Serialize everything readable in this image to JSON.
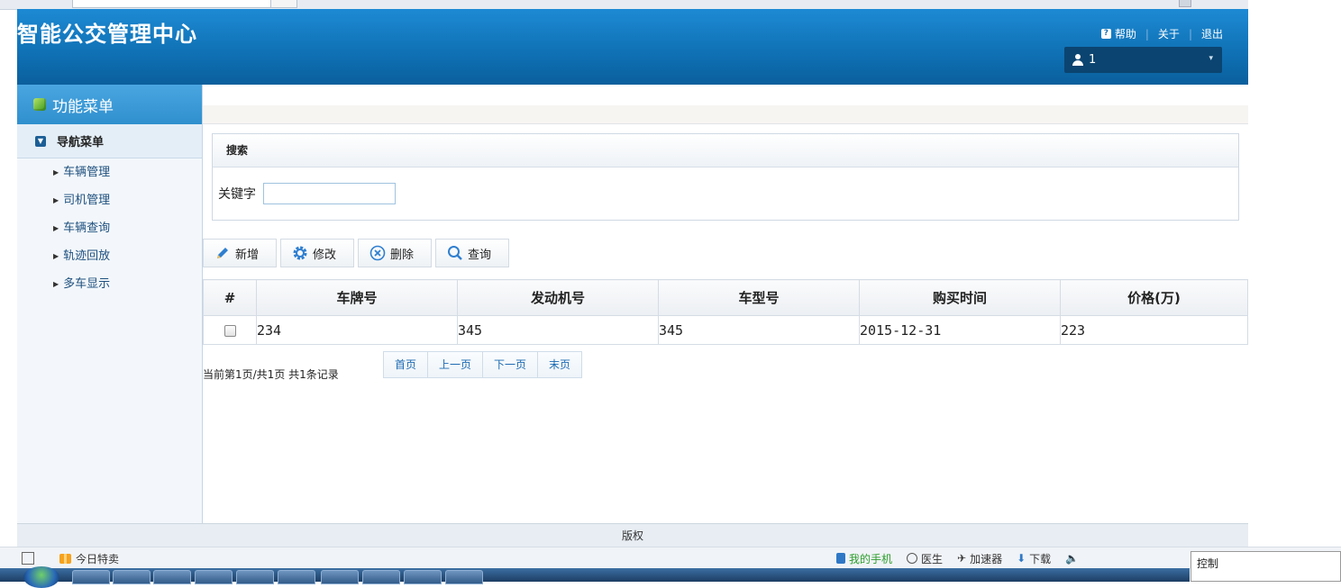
{
  "header": {
    "title": "智能公交管理中心",
    "links": {
      "help": "帮助",
      "about": "关于",
      "logout": "退出"
    },
    "user": "1"
  },
  "sidebar": {
    "heading": "功能菜单",
    "nav_title": "导航菜单",
    "items": [
      {
        "label": "车辆管理"
      },
      {
        "label": "司机管理"
      },
      {
        "label": "车辆查询"
      },
      {
        "label": "轨迹回放"
      },
      {
        "label": "多车显示"
      }
    ]
  },
  "search": {
    "title": "搜索",
    "keyword_label": "关键字",
    "keyword_value": ""
  },
  "toolbar": {
    "add": "新增",
    "edit": "修改",
    "delete": "删除",
    "query": "查询"
  },
  "table": {
    "columns": [
      "#",
      "车牌号",
      "发动机号",
      "车型号",
      "购买时间",
      "价格(万)"
    ],
    "rows": [
      {
        "plate": "234",
        "engine": "345",
        "model": "345",
        "purchase_date": "2015-12-31",
        "price": "223"
      }
    ]
  },
  "pager": {
    "info": "当前第1页/共1页  共1条记录",
    "first": "首页",
    "prev": "上一页",
    "next": "下一页",
    "last": "末页"
  },
  "footer": {
    "text": "版权"
  },
  "statusbar": {
    "today_deal": "今日特卖",
    "my_phone": "我的手机",
    "doctor": "医生",
    "accelerator": "加速器",
    "download": "下载",
    "control": "控制"
  },
  "colors": {
    "header_blue": "#0d6cae",
    "sidebar_head": "#2f8fce",
    "link": "#1c6ab2"
  }
}
